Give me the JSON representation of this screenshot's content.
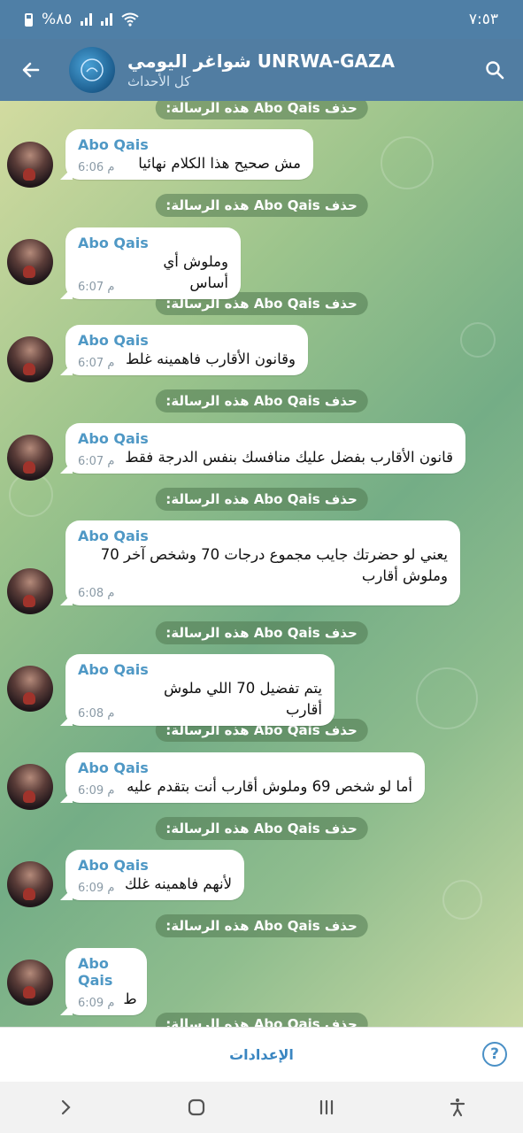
{
  "status_bar": {
    "battery": "%٨٥",
    "time": "٧:٥٣"
  },
  "header": {
    "title": "شواغر اليومي UNRWA-GAZA",
    "subtitle": "كل الأحداث",
    "back_icon": "arrow-left-icon",
    "search_icon": "search-icon"
  },
  "service_label": "حذف Abo Qais هذه الرسالة:",
  "messages": [
    {
      "sender": "Abo Qais",
      "text": "مش صحيح هذا الكلام نهائيا",
      "time": "6:06 م"
    },
    {
      "sender": "Abo Qais",
      "text": "وملوش أي أساس",
      "time": "6:07 م"
    },
    {
      "sender": "Abo Qais",
      "text": "وقانون الأقارب فاهمينه غلط",
      "time": "6:07 م"
    },
    {
      "sender": "Abo Qais",
      "text": "قانون الأقارب بفضل عليك منافسك بنفس الدرجة فقط",
      "time": "6:07 م"
    },
    {
      "sender": "Abo Qais",
      "text": "يعني لو حضرتك جايب مجموع درجات 70 وشخص آخر 70 وملوش أقارب",
      "time": "6:08 م"
    },
    {
      "sender": "Abo Qais",
      "text": "يتم تفضيل 70 اللي ملوش أقارب",
      "time": "6:08 م"
    },
    {
      "sender": "Abo Qais",
      "text": "أما لو شخص 69 وملوش أقارب أنت بتقدم عليه",
      "time": "6:09 م"
    },
    {
      "sender": "Abo Qais",
      "text": "لأنهم فاهمينه غلك",
      "time": "6:09 م"
    },
    {
      "sender": "Abo Qais",
      "text": "ط",
      "time": "6:09 م"
    }
  ],
  "footer": {
    "settings_label": "الإعدادات",
    "help_icon": "help-circle-icon"
  },
  "nav": {
    "back": "chevron-right-icon",
    "home": "home-icon",
    "recents": "recents-icon",
    "accessibility": "accessibility-icon"
  }
}
